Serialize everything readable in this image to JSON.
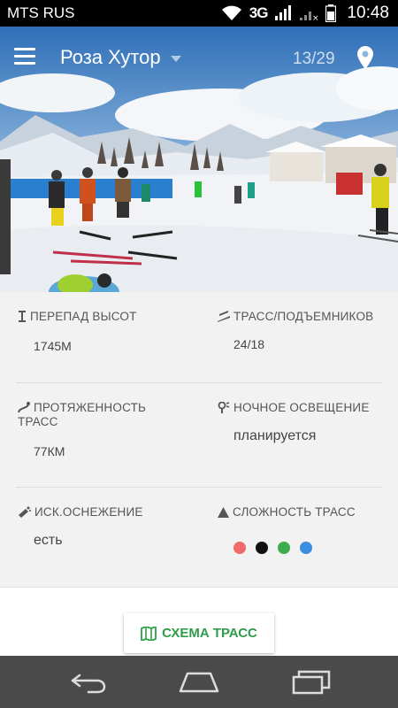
{
  "status_bar": {
    "carrier": "MTS RUS",
    "network": "3G",
    "time": "10:48"
  },
  "app_bar": {
    "title": "Роза Хутор",
    "page_counter": "13/29"
  },
  "icons": {
    "menu": "hamburger-menu-icon",
    "dropdown": "dropdown-arrow-icon",
    "location": "location-pin-icon"
  },
  "info": {
    "elevation": {
      "label": "ПЕРЕПАД ВЫСОТ",
      "value": "1745М"
    },
    "lifts": {
      "label": "ТРАСС/ПОДЪЕМНИКОВ",
      "value": "24/18"
    },
    "length": {
      "label_line1": "ПРОТЯЖЕННОСТЬ",
      "label_line2": "ТРАСС",
      "value": "77КМ"
    },
    "night_lighting": {
      "label": "НОЧНОЕ ОСВЕЩЕНИЕ",
      "value": "планируется"
    },
    "snowmaking": {
      "label": "ИСК.ОСНЕЖЕНИЕ",
      "value": "есть"
    },
    "difficulty": {
      "label": "СЛОЖНОСТЬ ТРАСС",
      "colors": [
        "#ef6a6a",
        "#111111",
        "#3cac4c",
        "#3a8fe0"
      ]
    }
  },
  "actions": {
    "trail_map_label": "СХЕМА ТРАСС"
  },
  "colors": {
    "accent_green": "#2e9d4a",
    "panel_bg": "#f2f2f2",
    "nav_bg": "#4a4a4a"
  }
}
